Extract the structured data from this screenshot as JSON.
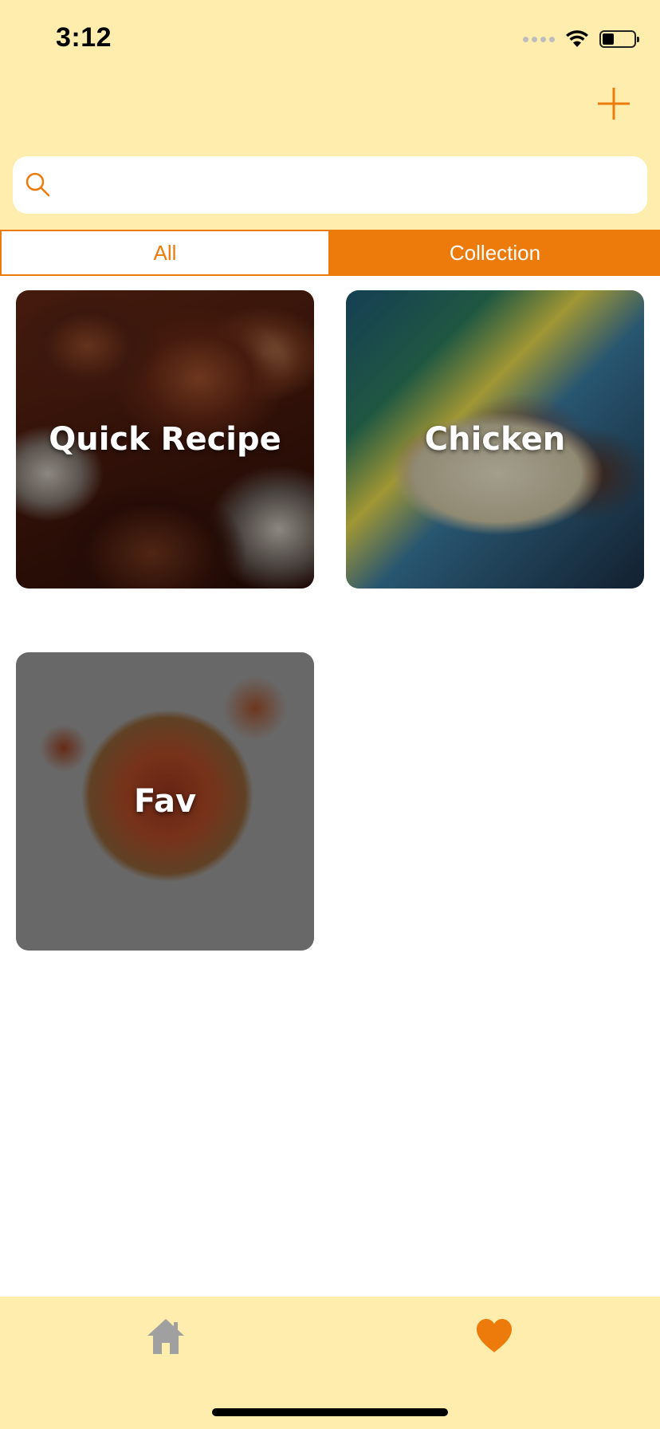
{
  "status_bar": {
    "time": "3:12"
  },
  "search": {
    "placeholder": "",
    "value": ""
  },
  "tabs": [
    {
      "label": "All",
      "active": false
    },
    {
      "label": "Collection",
      "active": true
    }
  ],
  "collections": [
    {
      "title": "Quick Recipe"
    },
    {
      "title": "Chicken"
    },
    {
      "title": "Fav"
    }
  ],
  "bottom_nav": {
    "items": [
      {
        "icon": "home-icon",
        "active": false
      },
      {
        "icon": "heart-icon",
        "active": true
      }
    ]
  },
  "colors": {
    "accent": "#EC7B0B",
    "header_bg": "#FFEDAD",
    "inactive_icon": "#A0A0A0"
  }
}
